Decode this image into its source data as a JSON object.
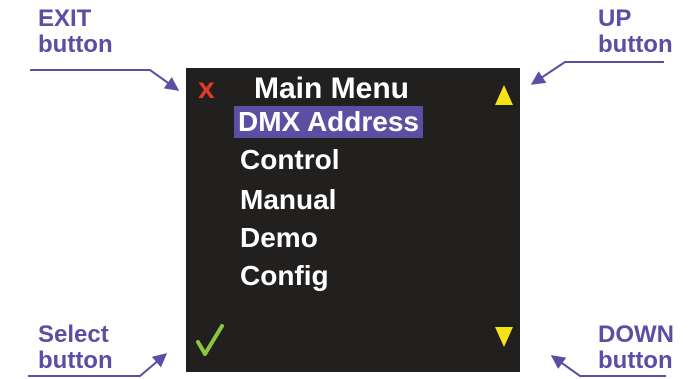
{
  "callouts": {
    "exit": [
      "EXIT",
      "button"
    ],
    "up": [
      "UP",
      "button"
    ],
    "select": [
      "Select",
      "button"
    ],
    "down": [
      "DOWN",
      "button"
    ]
  },
  "screen": {
    "title": "Main Menu",
    "exit_symbol": "x",
    "menu_items": [
      "DMX Address",
      "Control",
      "Manual",
      "Demo",
      "Config"
    ],
    "selected_item": "DMX Address"
  },
  "icons": {
    "exit": "close-icon",
    "select": "checkmark-icon",
    "up": "up-triangle-icon",
    "down": "down-triangle-icon"
  },
  "colors": {
    "callout_text": "#5a4fa2",
    "selection_highlight": "#5a4fa2",
    "screen_background": "#221f1f",
    "exit_icon": "#e03a2a",
    "check_icon": "#8cc63f",
    "arrow_icons": "#f5e11a"
  }
}
